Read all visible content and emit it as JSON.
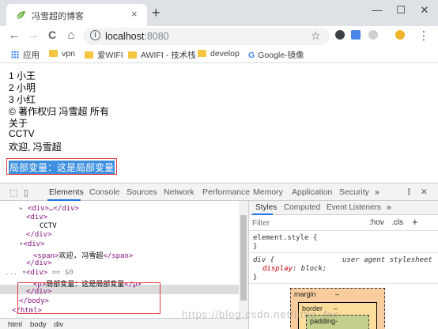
{
  "browser": {
    "tab_title": "冯雪超的博客",
    "tab_close": "×",
    "new_tab": "+",
    "window_controls": {
      "minimize": "—",
      "maximize": "☐",
      "close": "✕"
    },
    "url_host": "localhost",
    "url_port": ":8080",
    "nav": {
      "back": "←",
      "forward": "→",
      "reload": "C",
      "home": "⌂",
      "bookmark_star": "☆",
      "menu": "⋮"
    },
    "bookmarks": [
      {
        "label": "应用",
        "icon": "apps-grid-icon"
      },
      {
        "label": "vpn",
        "icon": "folder-icon"
      },
      {
        "label": "爱WIFI",
        "icon": "folder-icon"
      },
      {
        "label": "AWIFI - 技术栈",
        "icon": "folder-icon"
      },
      {
        "label": "develop",
        "icon": "folder-icon"
      },
      {
        "label": "Google-镜像",
        "icon": "google-icon"
      }
    ],
    "google_letter": "G",
    "colors": {
      "accent": "#1a73e8",
      "highlight": "#3d8fe0",
      "red_box": "#e03b3b"
    }
  },
  "page": {
    "lines": [
      "1 小王",
      "2 小明",
      "3 小红",
      "© 著作权归 冯雪超 所有",
      "关于",
      "CCTV",
      "欢迎, 冯雪超"
    ],
    "selected_text": "局部变量：这是局部变量"
  },
  "devtools": {
    "tabs": [
      "Elements",
      "Console",
      "Sources",
      "Network",
      "Performance",
      "Memory",
      "Application",
      "Security"
    ],
    "more": "»",
    "close": "✕",
    "tree": {
      "l1": "▸",
      "l1b": "<div>…</div>",
      "l2": "<div>",
      "l3": "CCTV",
      "l4": "</div>",
      "l5": "▾",
      "l5b": "<div>",
      "l6a": "<span>",
      "l6b": "欢迎, 冯雪超",
      "l6c": "</span>",
      "l7": "</div>",
      "l8dots": "...",
      "l8a": "▾",
      "l8b": "<div>",
      "l8c": " == $0",
      "l9a": "<p>",
      "l9b": "局部变量：这是局部变量",
      "l9c": "</p>",
      "l10": "</div>",
      "l11": "</body>",
      "l12": "</html>"
    },
    "breadcrumb": [
      "html",
      "body",
      "div"
    ],
    "styles": {
      "tabs": [
        "Styles",
        "Computed",
        "Event Listeners",
        "»"
      ],
      "filter_placeholder": "Filter",
      "hov": ":hov",
      "cls": ".cls",
      "add": "+",
      "element_style": "element.style {",
      "brace_close": "}",
      "rule_selector": "div {",
      "rule_source": "user agent stylesheet",
      "rule_prop": "display",
      "rule_value": "block;",
      "box_margin": "margin",
      "box_border": "border",
      "box_padding": "padding-",
      "dash": "–"
    }
  },
  "watermark": "https://blog.csdn.net/little_fxc"
}
